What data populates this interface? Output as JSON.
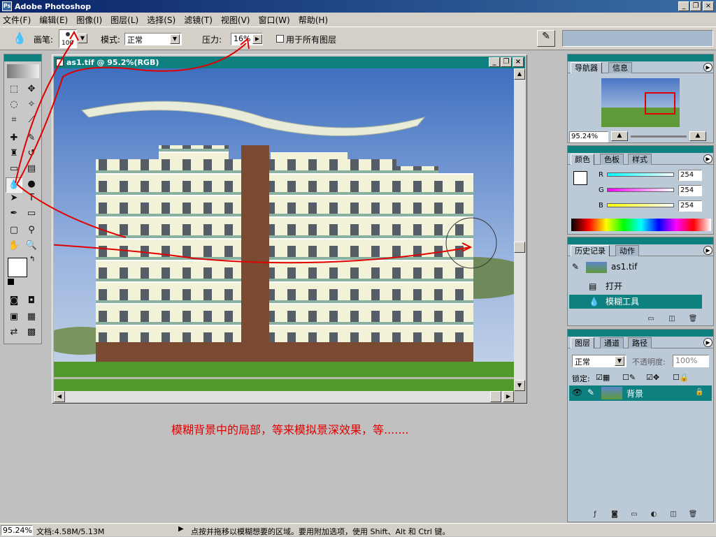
{
  "app": {
    "title": "Adobe Photoshop",
    "logo": "Ps"
  },
  "window_controls": {
    "minimize": "_",
    "restore": "❐",
    "close": "×"
  },
  "menu": [
    "文件(F)",
    "编辑(E)",
    "图像(I)",
    "图层(L)",
    "选择(S)",
    "滤镜(T)",
    "视图(V)",
    "窗口(W)",
    "帮助(H)"
  ],
  "options": {
    "brush_label": "画笔:",
    "brush_size": "100",
    "mode_label": "模式:",
    "mode_value": "正常",
    "pressure_label": "压力:",
    "pressure_value": "16%",
    "all_layers_label": "用于所有图层"
  },
  "document": {
    "title": "as1.tif @ 95.2%(RGB)"
  },
  "navigator": {
    "tabs": [
      "导航器",
      "信息"
    ],
    "zoom": "95.24%"
  },
  "color": {
    "tabs": [
      "颜色",
      "色板",
      "样式"
    ],
    "r_label": "R",
    "g_label": "G",
    "b_label": "B",
    "r": "254",
    "g": "254",
    "b": "254"
  },
  "history": {
    "tabs": [
      "历史记录",
      "动作"
    ],
    "snapshot": "as1.tif",
    "items": [
      "打开",
      "模糊工具"
    ]
  },
  "layers": {
    "tabs": [
      "图层",
      "通道",
      "路径"
    ],
    "blend_mode": "正常",
    "opacity_label": "不透明度:",
    "opacity": "100%",
    "lock_label": "锁定:",
    "layer_name": "背景"
  },
  "annotation": "模糊背景中的局部，等来模拟景深效果，等.......",
  "status": {
    "zoom": "95.24%",
    "doc": "文档:4.58M/5.13M",
    "hint": "点按并拖移以模糊想要的区域。要用附加选项，使用 Shift、Alt 和 Ctrl 键。"
  },
  "colors": {
    "teal": "#0f8080",
    "annotation_red": "#e00000",
    "panel_bg": "#bcc9d6"
  }
}
